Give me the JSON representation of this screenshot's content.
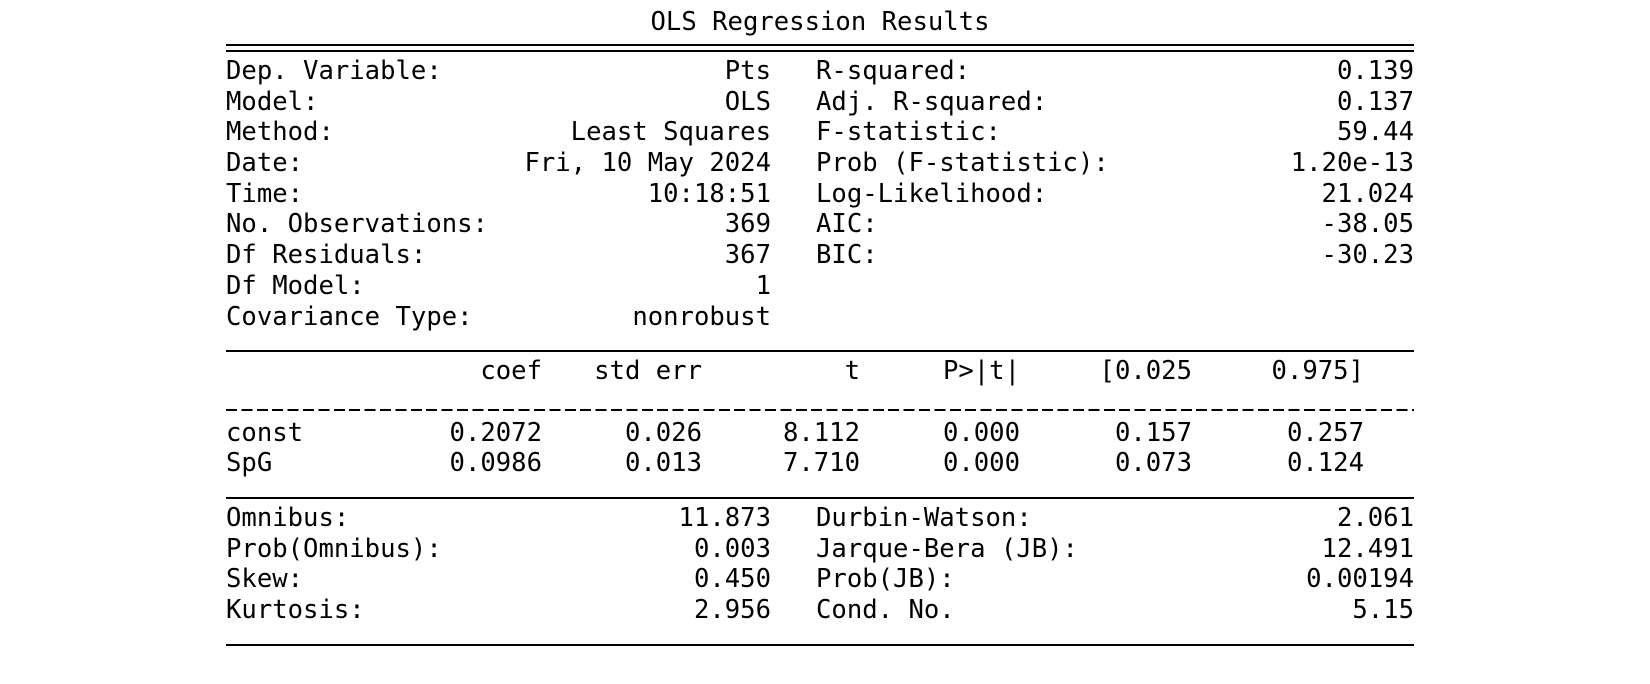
{
  "title": "OLS Regression Results",
  "top_left": [
    {
      "label": "Dep. Variable:",
      "value": "Pts"
    },
    {
      "label": "Model:",
      "value": "OLS"
    },
    {
      "label": "Method:",
      "value": "Least Squares"
    },
    {
      "label": "Date:",
      "value": "Fri, 10 May 2024"
    },
    {
      "label": "Time:",
      "value": "10:18:51"
    },
    {
      "label": "No. Observations:",
      "value": "369"
    },
    {
      "label": "Df Residuals:",
      "value": "367"
    },
    {
      "label": "Df Model:",
      "value": "1"
    },
    {
      "label": "Covariance Type:",
      "value": "nonrobust"
    }
  ],
  "top_right": [
    {
      "label": "R-squared:",
      "value": "0.139"
    },
    {
      "label": "Adj. R-squared:",
      "value": "0.137"
    },
    {
      "label": "F-statistic:",
      "value": "59.44"
    },
    {
      "label": "Prob (F-statistic):",
      "value": "1.20e-13"
    },
    {
      "label": "Log-Likelihood:",
      "value": "21.024"
    },
    {
      "label": "AIC:",
      "value": "-38.05"
    },
    {
      "label": "BIC:",
      "value": "-30.23"
    }
  ],
  "coef_table": {
    "headers": [
      "coef",
      "std err",
      "t",
      "P>|t|",
      "[0.025",
      "0.975]"
    ],
    "rows": [
      {
        "name": "const",
        "values": [
          "0.2072",
          "0.026",
          "8.112",
          "0.000",
          "0.157",
          "0.257"
        ]
      },
      {
        "name": "SpG",
        "values": [
          "0.0986",
          "0.013",
          "7.710",
          "0.000",
          "0.073",
          "0.124"
        ]
      }
    ]
  },
  "bottom_left": [
    {
      "label": "Omnibus:",
      "value": "11.873"
    },
    {
      "label": "Prob(Omnibus):",
      "value": "0.003"
    },
    {
      "label": "Skew:",
      "value": "0.450"
    },
    {
      "label": "Kurtosis:",
      "value": "2.956"
    }
  ],
  "bottom_right": [
    {
      "label": "Durbin-Watson:",
      "value": "2.061"
    },
    {
      "label": "Jarque-Bera (JB):",
      "value": "12.491"
    },
    {
      "label": "Prob(JB):",
      "value": "0.00194"
    },
    {
      "label": "Cond. No.",
      "value": "5.15"
    }
  ]
}
